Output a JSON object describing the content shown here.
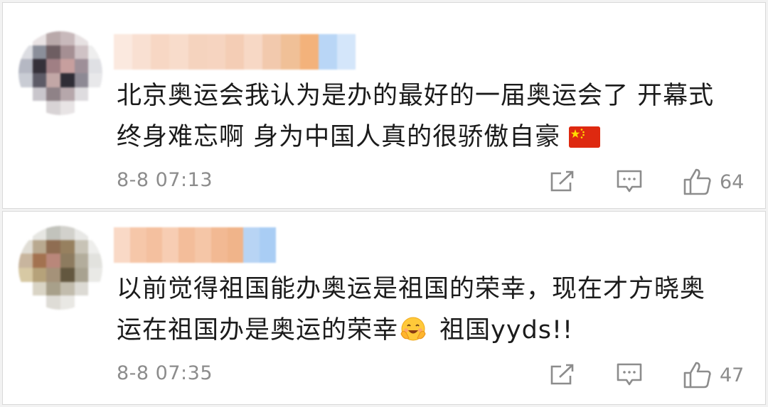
{
  "comments": [
    {
      "lines": [
        "北京奥运会我认为是办的最好的一届奥运会了 开幕式",
        "终身难忘啊  身为中国人真的很骄傲自豪"
      ],
      "emoji": "flag-cn",
      "time": "8-8 07:13",
      "likes": "64",
      "avatar_colors": [
        "#ffffff",
        "#e9e3e4",
        "#b9a9aa",
        "#c8b9bb",
        "#e7e1e2",
        "#ffffff",
        "#dcdde2",
        "#8b8f9a",
        "#6e5e62",
        "#a58f93",
        "#cfc2c5",
        "#eeeeee",
        "#b5b8c3",
        "#35313a",
        "#a07f84",
        "#c79f9e",
        "#9e8f98",
        "#dfe0e4",
        "#c9ccd4",
        "#5d5b67",
        "#c2a7a6",
        "#2f2d36",
        "#8d8994",
        "#e8e8ea",
        "#ffffff",
        "#c9c6cc",
        "#8f8287",
        "#b6a7ab",
        "#dedcdf",
        "#ffffff",
        "#ffffff",
        "#ffffff",
        "#d8d3d5",
        "#e8e4e5",
        "#ffffff",
        "#ffffff"
      ],
      "name_colors": [
        "#fbe9df",
        "#f9e0d2",
        "#f7d7c4",
        "#f8dccb",
        "#f5d3be",
        "#f6d4c0",
        "#f4cdb5",
        "#f7d8c5",
        "#f2c9ad",
        "#f0c097",
        "#f3b27b",
        "#b9d6f6",
        "#d4e6fa"
      ]
    },
    {
      "lines": [
        "以前觉得祖国能办奥运是祖国的荣幸，现在才方晓奥",
        "运在祖国办是奥运的荣幸"
      ],
      "tail": " 祖国yyds!!",
      "emoji": "smiling-face-with-hands",
      "time": "8-8 07:35",
      "likes": "47",
      "avatar_colors": [
        "#ffffff",
        "#e6e6e2",
        "#c2c3bc",
        "#d2d1cc",
        "#e8e8e6",
        "#ffffff",
        "#e0ddd5",
        "#b9a990",
        "#8f6d52",
        "#97805f",
        "#c8c3b6",
        "#eeeeec",
        "#c8b59e",
        "#a37250",
        "#b9877a",
        "#8d7b5f",
        "#b3ad9c",
        "#e2e2de",
        "#d7c9a4",
        "#b6a27a",
        "#a59279",
        "#63573f",
        "#a8a290",
        "#e9e9e6",
        "#ffffff",
        "#d9d4c5",
        "#a8a08a",
        "#c2bcad",
        "#dcdad4",
        "#ffffff",
        "#ffffff",
        "#ffffff",
        "#dedcd6",
        "#e9e8e4",
        "#ffffff",
        "#ffffff"
      ],
      "name_colors": [
        "#f9d9c6",
        "#f6c7a9",
        "#f4c09f",
        "#f7cdb3",
        "#f3bd9a",
        "#f5c6a7",
        "#f2b993",
        "#f0b48a",
        "#b8d4f4",
        "#a9cdf4"
      ]
    }
  ],
  "colors": {
    "meta_gray": "#8c8c8c",
    "text": "#1b1b1b",
    "border": "#d9d9d9"
  },
  "icons": {
    "share": "share-edit-icon",
    "comment": "comment-icon",
    "like": "thumbs-up-icon"
  }
}
